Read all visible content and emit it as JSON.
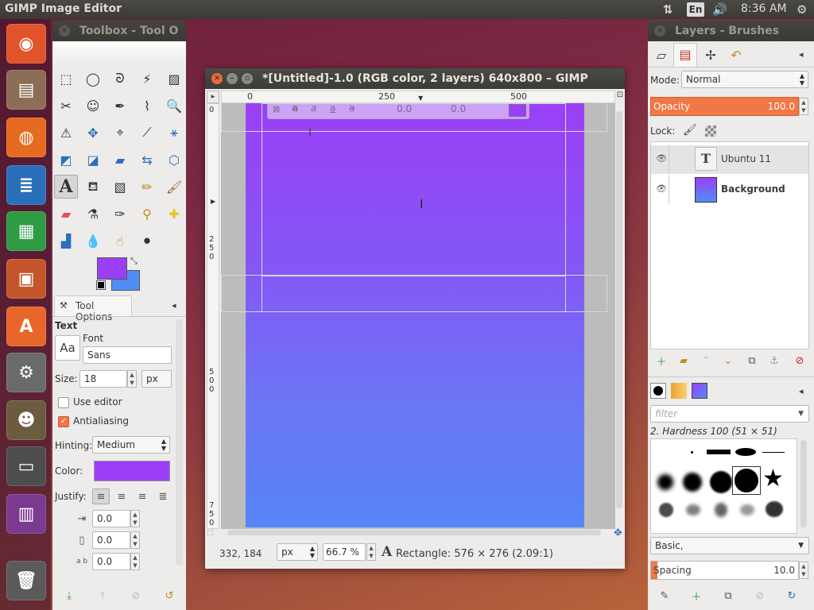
{
  "top_panel": {
    "title": "GIMP Image Editor",
    "lang": "En",
    "clock": "8:36 AM"
  },
  "launcher": {
    "items": [
      {
        "name": "ubuntu-dash-icon",
        "glyph": "◉",
        "color": "#e1532b"
      },
      {
        "name": "files-icon",
        "glyph": "▤",
        "color": "#8b6e55"
      },
      {
        "name": "firefox-icon",
        "glyph": "◍",
        "color": "#e66a1f"
      },
      {
        "name": "writer-icon",
        "glyph": "≣",
        "color": "#2a6fba"
      },
      {
        "name": "calc-icon",
        "glyph": "▦",
        "color": "#2f9b45"
      },
      {
        "name": "impress-icon",
        "glyph": "▣",
        "color": "#c5562b"
      },
      {
        "name": "software-center-icon",
        "glyph": "A",
        "color": "#e8662a"
      },
      {
        "name": "system-settings-icon",
        "glyph": "⚙",
        "color": "#6a6a6a"
      },
      {
        "name": "gimp-icon",
        "glyph": "☻",
        "color": "#6b5b3f"
      },
      {
        "name": "save-disk-icon",
        "glyph": "▭",
        "color": "#4d4d4d"
      },
      {
        "name": "workspace-switcher-icon",
        "glyph": "▥",
        "color": "#7b3a8f"
      },
      {
        "name": "trash-icon",
        "glyph": "🗑",
        "color": "#5a5a5a"
      }
    ]
  },
  "toolbox": {
    "title": "Toolbox - Tool O"
  },
  "tool_options": {
    "tab": "Tool Options",
    "section": "Text",
    "font_label": "Font",
    "font_value": "Sans",
    "size_label": "Size:",
    "size_value": "18",
    "size_unit": "px",
    "use_editor": "Use editor",
    "antialiasing": "Antialiasing",
    "hinting_label": "Hinting:",
    "hinting_value": "Medium",
    "color_label": "Color:",
    "color_value": "#9b3ff7",
    "justify_label": "Justify:",
    "indent": "0.0",
    "line_spacing": "0.0",
    "letter_spacing": "0.0",
    "font_icon_text": "Aa"
  },
  "colors": {
    "fg": "#9b3ff7",
    "bg": "#4f8ef7"
  },
  "gimp_window": {
    "title": "*[Untitled]-1.0 (RGB color, 2 layers) 640x800 – GIMP",
    "ruler_h": [
      "0",
      "250",
      "500"
    ],
    "ruler_v": [
      "0",
      "250",
      "500",
      "750"
    ],
    "overlay_values": [
      "0.0",
      "0.0"
    ],
    "status": {
      "coords": "332, 184",
      "unit": "px",
      "zoom": "66.7 %",
      "message": "Rectangle: 576 × 276  (2.09:1)"
    }
  },
  "layers_panel": {
    "title": "Layers - Brushes",
    "mode_label": "Mode:",
    "mode_value": "Normal",
    "opacity_label": "Opacity",
    "opacity_value": "100.0",
    "lock_label": "Lock:",
    "layers": [
      {
        "name": "Ubuntu 11"
      },
      {
        "name": "Background"
      }
    ]
  },
  "brushes_panel": {
    "filter_placeholder": "filter",
    "brush_name": "2. Hardness 100 (51 × 51)",
    "preset": "Basic,",
    "spacing_label": "Spacing",
    "spacing_value": "10.0"
  }
}
